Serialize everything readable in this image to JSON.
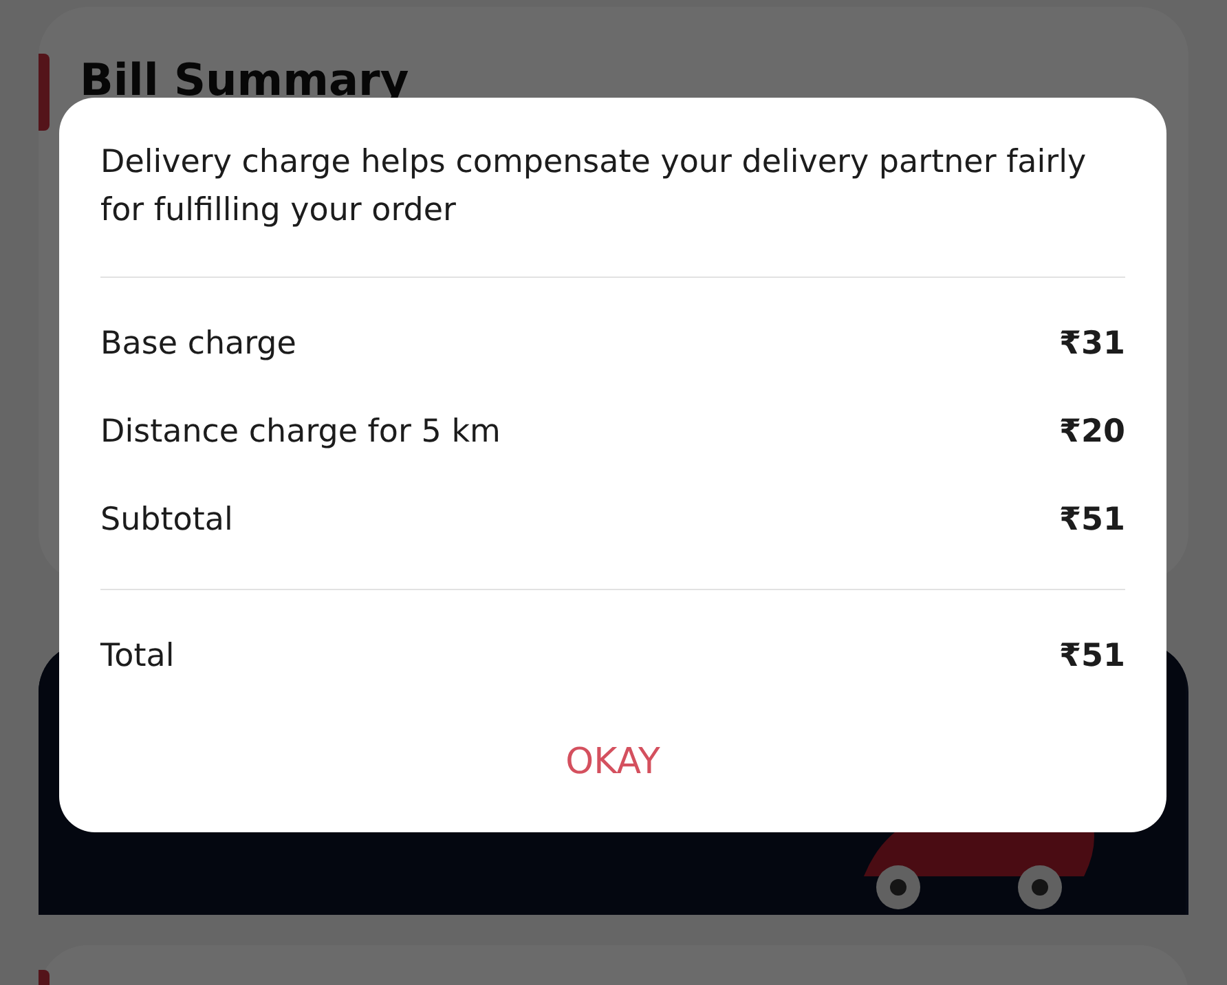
{
  "background": {
    "bill_summary": {
      "title": "Bill Summary"
    }
  },
  "dialog": {
    "message": "Delivery charge helps compensate your delivery partner fairly for fulfilling your order",
    "charges": [
      {
        "label": "Base charge",
        "amount": "₹31"
      },
      {
        "label": "Distance charge for 5 km",
        "amount": "₹20"
      },
      {
        "label": "Subtotal",
        "amount": "₹51"
      }
    ],
    "total": {
      "label": "Total",
      "amount": "₹51"
    },
    "button": "OKAY"
  }
}
